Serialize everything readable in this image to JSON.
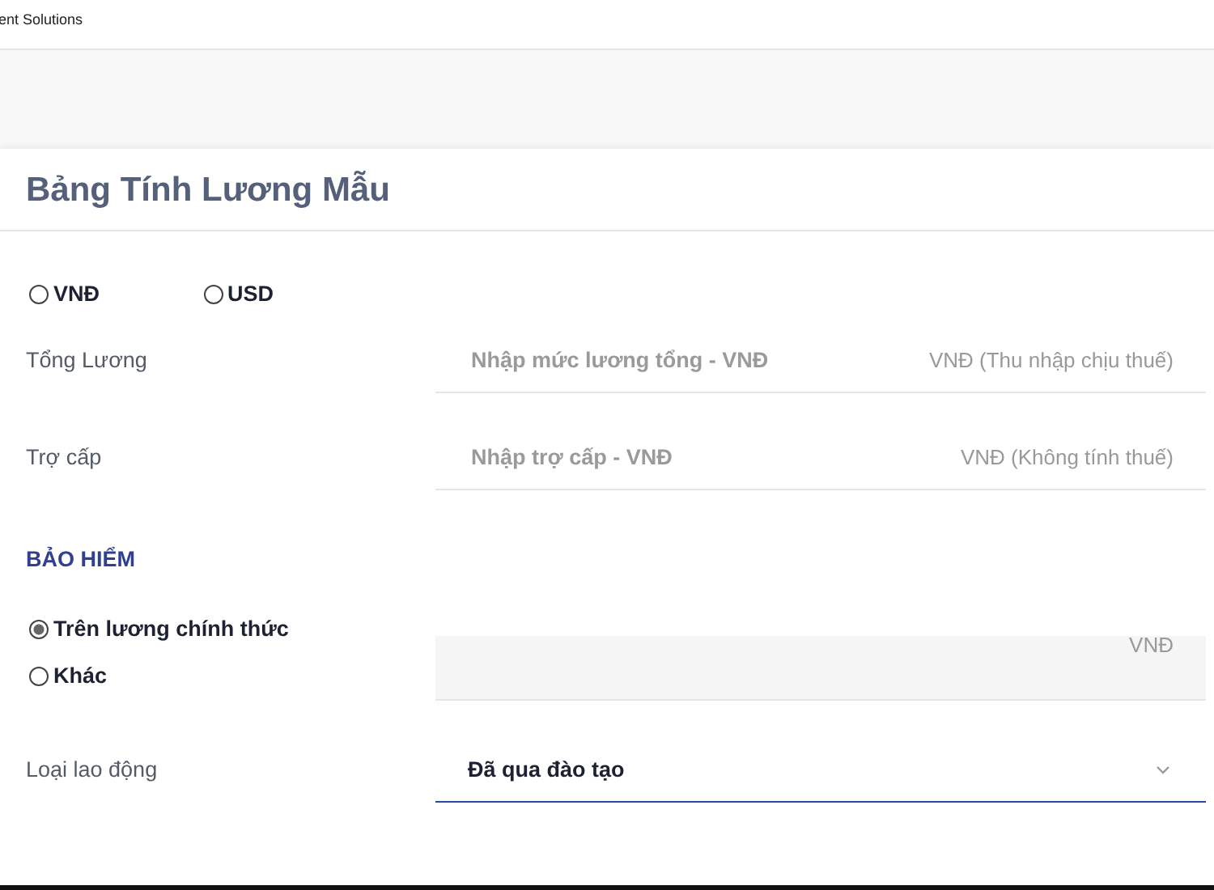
{
  "header": {
    "brand_text": "ent Solutions"
  },
  "panel": {
    "title": "Bảng Tính Lương Mẫu"
  },
  "currency": [
    {
      "label": "VNĐ",
      "selected": false
    },
    {
      "label": "USD",
      "selected": false
    }
  ],
  "fields": [
    {
      "label": "Tổng Lương",
      "placeholder": "Nhập mức lương tổng - VNĐ",
      "suffix": "VNĐ (Thu nhập chịu thuế)"
    },
    {
      "label": "Trợ cấp",
      "placeholder": "Nhập trợ cấp - VNĐ",
      "suffix": "VNĐ (Không tính thuế)"
    }
  ],
  "insurance": {
    "heading": "BẢO HIỂM",
    "options": [
      {
        "label": "Trên lương chính thức",
        "selected": true
      },
      {
        "label": "Khác",
        "selected": false
      }
    ],
    "field": {
      "suffix": "VNĐ",
      "disabled": true
    }
  },
  "labor_type": {
    "label": "Loại lao động",
    "value": "Đã qua đào tạo"
  }
}
